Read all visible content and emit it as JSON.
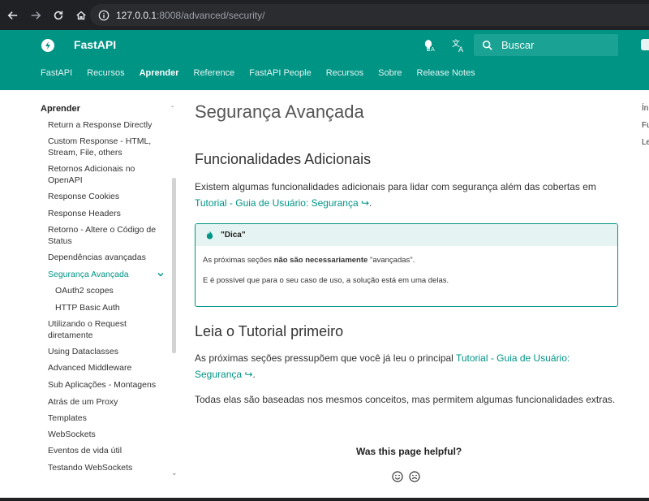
{
  "browser": {
    "url_host": "127.0.0.1",
    "url_rest": ":8008/advanced/security/"
  },
  "header": {
    "brand": "FastAPI",
    "search_placeholder": "Buscar",
    "tabs": [
      "FastAPI",
      "Recursos",
      "Aprender",
      "Reference",
      "FastAPI People",
      "Recursos",
      "Sobre",
      "Release Notes"
    ],
    "active_tab": "Aprender",
    "color": "#009485"
  },
  "sidebar": {
    "title": "Aprender",
    "items": [
      "Return a Response Directly",
      "Custom Response - HTML, Stream, File, others",
      "Retornos Adicionais no OpenAPI",
      "Response Cookies",
      "Response Headers",
      "Retorno - Altere o Código de Status",
      "Dependências avançadas",
      "Segurança Avançada",
      "OAuth2 scopes",
      "HTTP Basic Auth",
      "Utilizando o Request diretamente",
      "Using Dataclasses",
      "Advanced Middleware",
      "Sub Aplicações - Montagens",
      "Atrás de um Proxy",
      "Templates",
      "WebSockets",
      "Eventos de vida útil",
      "Testando WebSockets"
    ]
  },
  "content": {
    "title": "Segurança Avançada",
    "section1": {
      "heading": "Funcionalidades Adicionais",
      "text": "Existem algumas funcionalidades adicionais para lidar com segurança além das cobertas em ",
      "link": "Tutorial - Guia de Usuário: Segurança ↪",
      "end": "."
    },
    "tip": {
      "title": "\"Dica\"",
      "line1_before": "As próximas seções ",
      "line1_bold": "não são necessariamente",
      "line1_after": " \"avançadas\".",
      "line2": "E é possível que para o seu caso de uso, a solução está em uma delas."
    },
    "section2": {
      "heading": "Leia o Tutorial primeiro",
      "text": "As próximas seções pressupõem que você já leu o principal ",
      "link": "Tutorial - Guia de Usuário: Segurança ↪",
      "end": ".",
      "text2": "Todas elas são baseadas nos mesmos conceitos, mas permitem algumas funcionalidades extras."
    },
    "helpful": "Was this page helpful?"
  },
  "toc": [
    "Ín",
    "Fu",
    "Le"
  ]
}
